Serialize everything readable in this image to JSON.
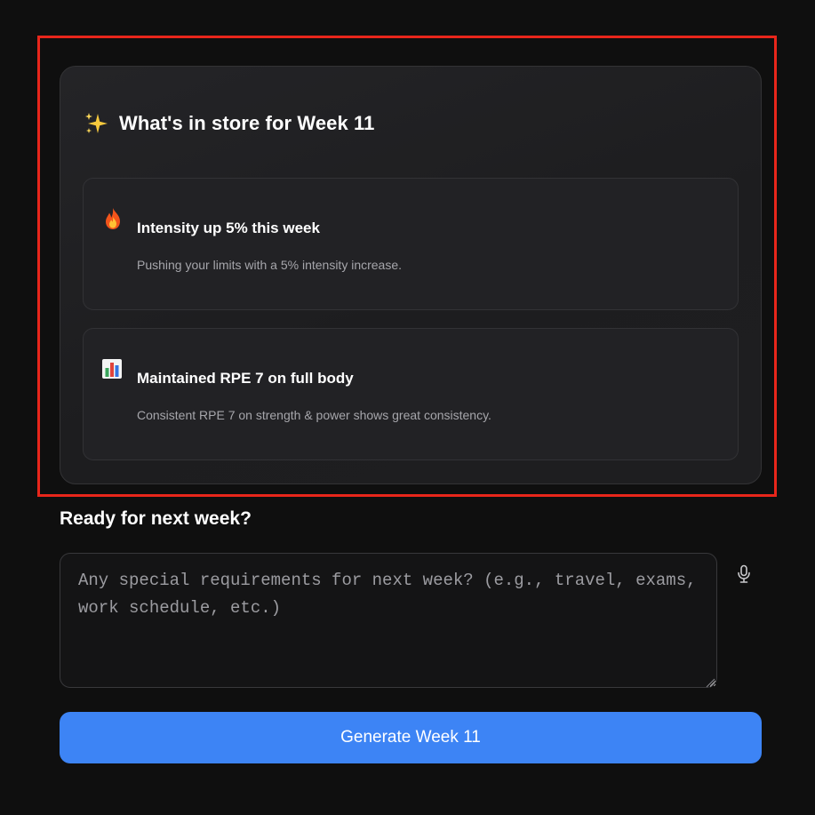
{
  "preview": {
    "icon": "sparkles-icon",
    "title": "What's in store for Week 11",
    "insights": [
      {
        "icon": "fire-icon",
        "title": "Intensity up 5% this week",
        "description": "Pushing your limits with a 5% intensity increase."
      },
      {
        "icon": "bar-chart-icon",
        "title": "Maintained RPE 7 on full body",
        "description": "Consistent RPE 7 on strength & power shows great consistency."
      }
    ]
  },
  "next_week": {
    "heading": "Ready for next week?",
    "input_value": "",
    "input_placeholder": "Any special requirements for next week? (e.g., travel, exams, work schedule, etc.)",
    "mic_icon": "microphone-icon",
    "generate_label": "Generate Week 11"
  },
  "colors": {
    "background": "#0f0f0f",
    "card": "#1f1f21",
    "highlight": "#e8261b",
    "accent": "#3d84f5",
    "muted_text": "#a6a6ab"
  }
}
